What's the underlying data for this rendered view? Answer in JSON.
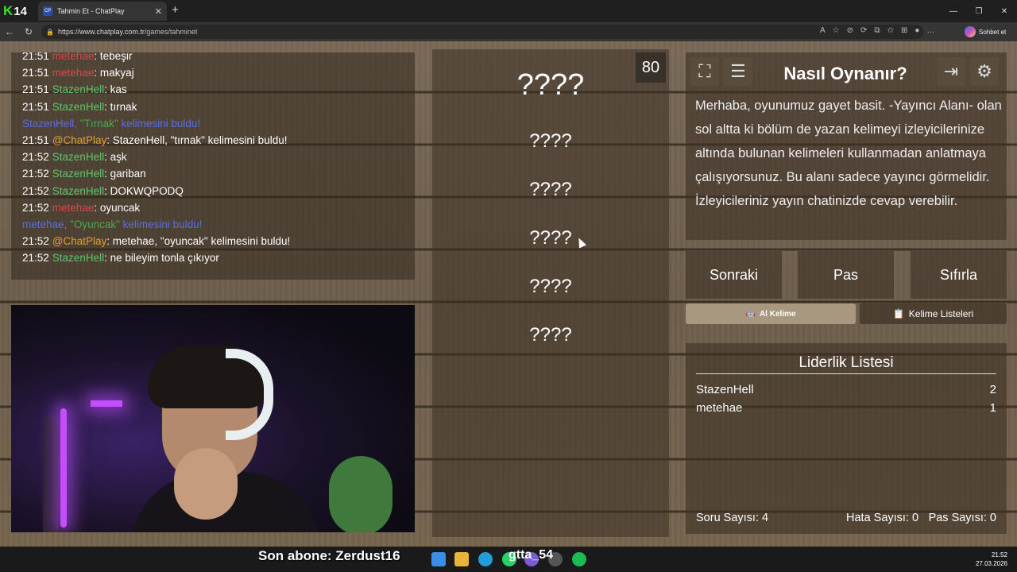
{
  "browser": {
    "brand_number": "14",
    "tab_title": "Tahmin Et - ChatPlay",
    "tab_favicon": "CP",
    "url_host": "https://www.chatplay.com.tr",
    "url_path": "/games/tahminet",
    "copilot_label": "Sohbet et"
  },
  "chat": {
    "messages": [
      {
        "time": "21:51",
        "user": "metehae",
        "user_color": "red",
        "text": ": tebeşir"
      },
      {
        "time": "21:51",
        "user": "metehae",
        "user_color": "red",
        "text": ": makyaj"
      },
      {
        "time": "21:51",
        "user": "StazenHell",
        "user_color": "green",
        "text": ": kas"
      },
      {
        "time": "21:51",
        "user": "StazenHell",
        "user_color": "green",
        "text": ": tırnak"
      },
      {
        "system": true,
        "user": "StazenHell, ",
        "word": "\"Tırnak\"",
        "text": " kelimesini buldu!"
      },
      {
        "time": "21:51",
        "user": "@ChatPlay",
        "user_color": "orange",
        "text": ": StazenHell, \"tırnak\" kelimesini buldu!"
      },
      {
        "time": "21:52",
        "user": "StazenHell",
        "user_color": "green",
        "text": ": aşk"
      },
      {
        "time": "21:52",
        "user": "StazenHell",
        "user_color": "green",
        "text": ": gariban"
      },
      {
        "time": "21:52",
        "user": "StazenHell",
        "user_color": "green",
        "text": ": DOKWQPODQ"
      },
      {
        "time": "21:52",
        "user": "metehae",
        "user_color": "red",
        "text": ": oyuncak"
      },
      {
        "system": true,
        "user": "metehae, ",
        "word": "\"Oyuncak\"",
        "text": " kelimesini buldu!"
      },
      {
        "time": "21:52",
        "user": "@ChatPlay",
        "user_color": "orange",
        "text": ": metehae, \"oyuncak\" kelimesini buldu!"
      },
      {
        "time": "21:52",
        "user": "StazenHell",
        "user_color": "green",
        "text": ": ne bileyim tonla çıkıyor"
      }
    ]
  },
  "game": {
    "timer": "80",
    "words": [
      "????",
      "????",
      "????",
      "????",
      "????",
      "????"
    ]
  },
  "howto": {
    "title": "Nasıl Oynanır?",
    "text": "Merhaba, oyunumuz gayet basit. -Yayıncı Alanı- olan sol altta ki bölüm de yazan kelimeyi izleyicilerinize altında bulunan kelimeleri kullanmadan anlatmaya çalışıyorsunuz. Bu alanı sadece yayıncı görmelidir. İzleyicileriniz yayın chatinizde cevap verebilir."
  },
  "controls": {
    "next": "Sonraki",
    "pass": "Pas",
    "reset": "Sıfırla",
    "get_word": "Al Kelime",
    "word_lists": "Kelime Listeleri"
  },
  "leaderboard": {
    "title": "Liderlik Listesi",
    "rows": [
      {
        "name": "StazenHell",
        "score": "2"
      },
      {
        "name": "metehae",
        "score": "1"
      }
    ],
    "question_count": "Soru Sayısı: 4",
    "error_count": "Hata Sayısı: 0",
    "pass_count": "Pas Sayısı: 0"
  },
  "taskbar": {
    "last_sub": "Son abone: Zerdust16",
    "overlay_text": "gtta_54",
    "time": "21:52",
    "date": "27.03.2026"
  },
  "colors": {
    "green_user": "#60c56a",
    "red_user": "#d8474d",
    "orange_user": "#e0a030",
    "system": "#5c6de0"
  }
}
